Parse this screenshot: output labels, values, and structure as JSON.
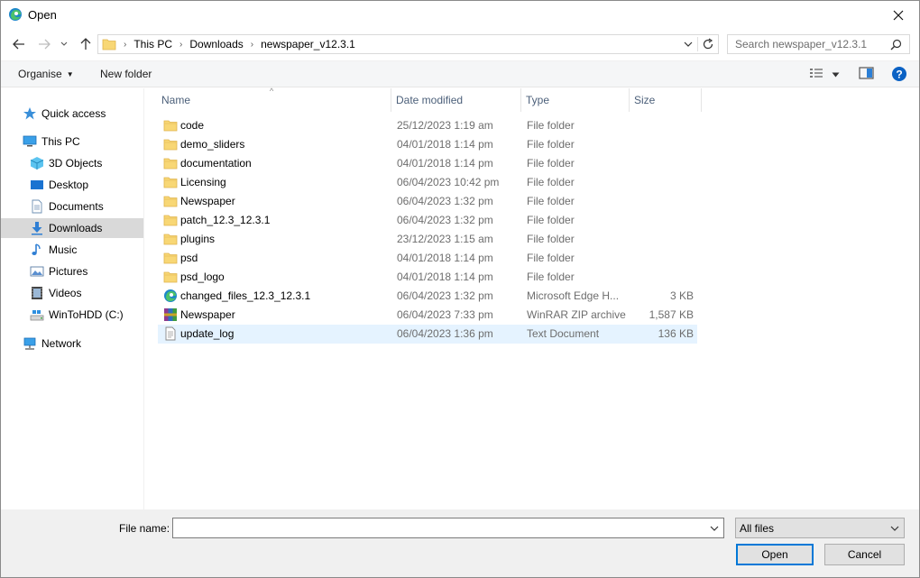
{
  "window": {
    "title": "Open"
  },
  "address": {
    "crumbs": [
      "This PC",
      "Downloads",
      "newspaper_v12.3.1"
    ]
  },
  "search": {
    "placeholder": "Search newspaper_v12.3.1"
  },
  "toolbar": {
    "organise": "Organise",
    "new_folder": "New folder"
  },
  "sidebar": {
    "items": [
      {
        "label": "Quick access",
        "icon": "star-icon"
      },
      {
        "label": "This PC",
        "icon": "computer-icon"
      },
      {
        "label": "3D Objects",
        "icon": "cube-icon"
      },
      {
        "label": "Desktop",
        "icon": "desktop-icon"
      },
      {
        "label": "Documents",
        "icon": "document-icon"
      },
      {
        "label": "Downloads",
        "icon": "download-icon",
        "selected": true
      },
      {
        "label": "Music",
        "icon": "music-icon"
      },
      {
        "label": "Pictures",
        "icon": "picture-icon"
      },
      {
        "label": "Videos",
        "icon": "video-icon"
      },
      {
        "label": "WinToHDD (C:)",
        "icon": "drive-icon"
      },
      {
        "label": "Network",
        "icon": "network-icon"
      }
    ]
  },
  "columns": {
    "name": "Name",
    "date": "Date modified",
    "type": "Type",
    "size": "Size"
  },
  "files": [
    {
      "name": "code",
      "date": "25/12/2023 1:19 am",
      "type": "File folder",
      "size": "",
      "icon": "folder-icon"
    },
    {
      "name": "demo_sliders",
      "date": "04/01/2018 1:14 pm",
      "type": "File folder",
      "size": "",
      "icon": "folder-icon"
    },
    {
      "name": "documentation",
      "date": "04/01/2018 1:14 pm",
      "type": "File folder",
      "size": "",
      "icon": "folder-icon"
    },
    {
      "name": "Licensing",
      "date": "06/04/2023 10:42 pm",
      "type": "File folder",
      "size": "",
      "icon": "folder-icon"
    },
    {
      "name": "Newspaper",
      "date": "06/04/2023 1:32 pm",
      "type": "File folder",
      "size": "",
      "icon": "folder-icon"
    },
    {
      "name": "patch_12.3_12.3.1",
      "date": "06/04/2023 1:32 pm",
      "type": "File folder",
      "size": "",
      "icon": "folder-icon"
    },
    {
      "name": "plugins",
      "date": "23/12/2023 1:15 am",
      "type": "File folder",
      "size": "",
      "icon": "folder-icon"
    },
    {
      "name": "psd",
      "date": "04/01/2018 1:14 pm",
      "type": "File folder",
      "size": "",
      "icon": "folder-icon"
    },
    {
      "name": "psd_logo",
      "date": "04/01/2018 1:14 pm",
      "type": "File folder",
      "size": "",
      "icon": "folder-icon"
    },
    {
      "name": "changed_files_12.3_12.3.1",
      "date": "06/04/2023 1:32 pm",
      "type": "Microsoft Edge H...",
      "size": "3 KB",
      "icon": "edge-icon"
    },
    {
      "name": "Newspaper",
      "date": "06/04/2023 7:33 pm",
      "type": "WinRAR ZIP archive",
      "size": "1,587 KB",
      "icon": "winrar-icon"
    },
    {
      "name": "update_log",
      "date": "06/04/2023 1:36 pm",
      "type": "Text Document",
      "size": "136 KB",
      "icon": "text-file-icon",
      "selected": true
    }
  ],
  "bottom": {
    "file_name_label": "File name:",
    "file_name_value": "",
    "filter": "All files",
    "open": "Open",
    "cancel": "Cancel"
  },
  "colors": {
    "accent": "#0078d7",
    "selection": "#e5f3ff",
    "sidebar_selected": "#d9d9d9",
    "folder": "#f8d775"
  }
}
